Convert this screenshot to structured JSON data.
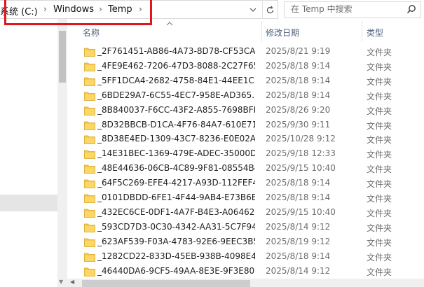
{
  "address": {
    "crumbs": [
      "系统 (C:)",
      "Windows",
      "Temp"
    ],
    "refresh_icon": "refresh-icon",
    "dropdown_icon": "chevron-down-icon"
  },
  "search": {
    "placeholder": "在 Temp 中搜索",
    "icon": "search-icon"
  },
  "columns": {
    "name": "名称",
    "date": "修改日期",
    "type": "类型"
  },
  "highlight_color": "#e0161c",
  "folder_color": "#f5c94c",
  "files": [
    {
      "name": "_2F761451-AB86-4A73-8D78-CF53CA...",
      "date": "2025/8/21 9:19",
      "type": "文件夹"
    },
    {
      "name": "_4FE9E462-7206-47D3-8088-2C27F65...",
      "date": "2025/8/18 9:14",
      "type": "文件夹"
    },
    {
      "name": "_5FF1DCA4-2682-4758-84E1-44EE1C...",
      "date": "2025/8/18 9:14",
      "type": "文件夹"
    },
    {
      "name": "_6BDE29A7-6C55-4EC7-958E-AD365...",
      "date": "2025/8/18 9:14",
      "type": "文件夹"
    },
    {
      "name": "_8B840037-F6CC-43F2-A855-7698BFB...",
      "date": "2025/8/26 9:20",
      "type": "文件夹"
    },
    {
      "name": "_8D32BBCB-D1CA-4F76-84A7-610E71...",
      "date": "2025/9/30 9:11",
      "type": "文件夹"
    },
    {
      "name": "_8D38E4ED-1309-43C7-8236-E0E02A...",
      "date": "2025/10/28 9:12",
      "type": "文件夹"
    },
    {
      "name": "_14E31BEC-1369-479E-ADEC-35000D...",
      "date": "2025/9/18 12:33",
      "type": "文件夹"
    },
    {
      "name": "_48E44636-06CB-4C89-9F81-08554B4...",
      "date": "2025/9/15 10:40",
      "type": "文件夹"
    },
    {
      "name": "_64F5C269-EFE4-4217-A93D-112FEF4...",
      "date": "2025/8/18 9:14",
      "type": "文件夹"
    },
    {
      "name": "_0101DBDD-6FE1-4F44-9AB4-E73B6E...",
      "date": "2025/8/18 9:14",
      "type": "文件夹"
    },
    {
      "name": "_432EC6CE-0DF1-4A7F-B4E3-A06462...",
      "date": "2025/9/15 10:40",
      "type": "文件夹"
    },
    {
      "name": "_593CD7D3-0C30-4342-AA31-5C7F94...",
      "date": "2025/8/14 9:12",
      "type": "文件夹"
    },
    {
      "name": "_623AF539-F03A-4783-92E6-9EEC3B5...",
      "date": "2025/8/19 9:12",
      "type": "文件夹"
    },
    {
      "name": "_1282CD22-833D-45EB-938B-4098E4...",
      "date": "2025/8/18 9:14",
      "type": "文件夹"
    },
    {
      "name": "_46440DA6-9CF5-49AA-8E3E-9F3E80...",
      "date": "2025/8/14 9:12",
      "type": "文件夹"
    }
  ]
}
